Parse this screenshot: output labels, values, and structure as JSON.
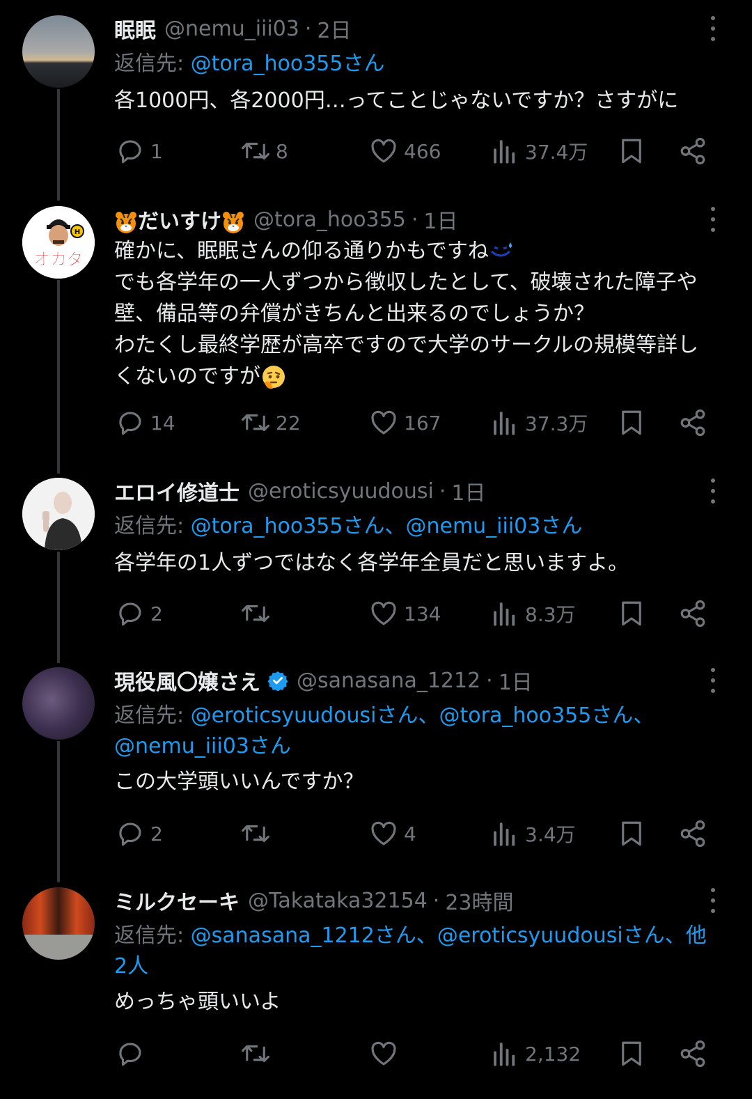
{
  "tweets": [
    {
      "name": "眠眠",
      "handle": "@nemu_iii03",
      "time": "2日",
      "reply_prefix": "返信先: ",
      "reply_to": "@tora_hoo355さん",
      "reply_to2": "",
      "body": [
        "各1000円、各2000円…ってことじゃないですか？さすがに"
      ],
      "replies": "1",
      "retweets": "8",
      "likes": "466",
      "views": "37.4万"
    },
    {
      "name_prefix_emoji": "tiger-face",
      "name": "だいすけ",
      "name_suffix_emoji": "tiger-face",
      "handle": "@tora_hoo355",
      "time": "1日",
      "avatar_text": "オカダ",
      "body": [
        "確かに、眠眠さんの仰る通りかもですね",
        "でも各学年の一人ずつから徴収したとして、破壊された障子や",
        "壁、備品等の弁償がきちんと出来るのでしょうか？",
        "わたくし最終学歴が高卒ですので大学のサークルの規模等詳し",
        "くないのですが"
      ],
      "replies": "14",
      "retweets": "22",
      "likes": "167",
      "views": "37.3万"
    },
    {
      "name": "エロイ修道士",
      "handle": "@eroticsyuudousi",
      "time": "1日",
      "reply_prefix": "返信先: ",
      "reply_to": "@tora_hoo355さん、@nemu_iii03さん",
      "reply_to2": "",
      "body": [
        "各学年の1人ずつではなく各学年全員だと思いますよ。"
      ],
      "replies": "2",
      "retweets": "",
      "likes": "134",
      "views": "8.3万"
    },
    {
      "name": "現役風〇嬢さえ",
      "handle": "@sanasana_1212",
      "time": "1日",
      "reply_prefix": "返信先: ",
      "reply_to": "@eroticsyuudousiさん、@tora_hoo355さん、",
      "reply_to2": "@nemu_iii03さん",
      "body": [
        "この大学頭いいんですか？"
      ],
      "replies": "2",
      "retweets": "",
      "likes": "4",
      "views": "3.4万"
    },
    {
      "name": "ミルクセーキ",
      "handle": "@Takataka32154",
      "time": "23時間",
      "reply_prefix": "返信先: ",
      "reply_to": "@sanasana_1212さん、@eroticsyuudousiさん、他",
      "reply_to2": "2人",
      "body": [
        "めっちゃ頭いいよ"
      ],
      "replies": "",
      "retweets": "",
      "likes": "",
      "views": "2,132"
    }
  ],
  "colors": {
    "background": "#000000",
    "text": "#e7e9ea",
    "muted": "#71767b",
    "link": "#1d9bf0",
    "thread_line": "#333639"
  }
}
